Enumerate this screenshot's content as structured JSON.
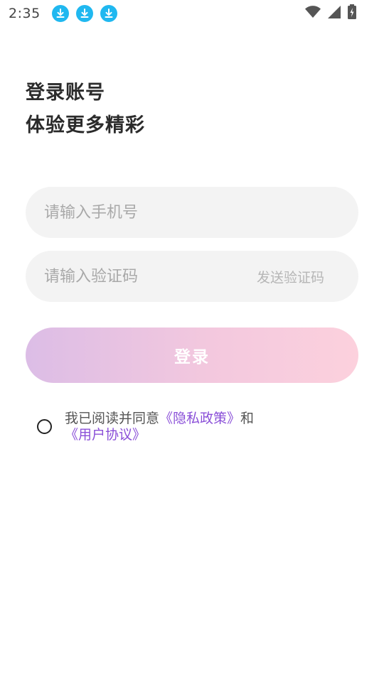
{
  "status_bar": {
    "time": "2:35",
    "notifications": [
      "download-icon",
      "download-icon",
      "download-icon"
    ],
    "right_icons": [
      "wifi-icon",
      "signal-icon",
      "battery-icon"
    ]
  },
  "title": {
    "line1": "登录账号",
    "line2": "体验更多精彩"
  },
  "phone_input": {
    "placeholder": "请输入手机号",
    "value": ""
  },
  "code_input": {
    "placeholder": "请输入验证码",
    "value": "",
    "send_code_label": "发送验证码"
  },
  "login_button": {
    "label": "登录"
  },
  "agreement": {
    "checked": false,
    "prefix": "我已阅读并同意",
    "privacy_link": "《隐私政策》",
    "conjunction": "和",
    "terms_link": "《用户协议》"
  },
  "colors": {
    "accent_link": "#8a4fd8",
    "button_gradient_start": "#dcbde6",
    "button_gradient_end": "#fcd1dd",
    "field_background": "#f3f3f3",
    "download_badge": "#20b8f0"
  }
}
